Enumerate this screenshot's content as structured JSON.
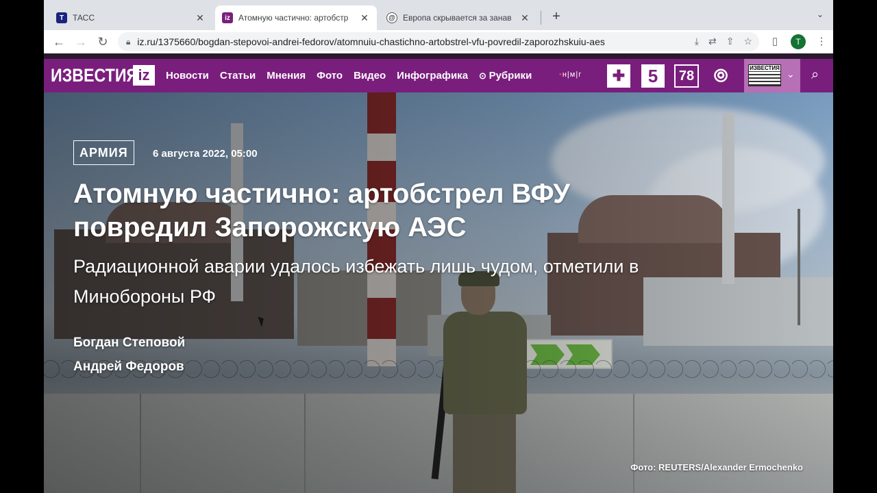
{
  "tabs": [
    {
      "title": "ТАСС",
      "favicon": "Т",
      "color": "#1a237e",
      "active": false
    },
    {
      "title": "Атомную частично: артобстр",
      "favicon": "iz",
      "color": "#7a1e7d",
      "active": true
    },
    {
      "title": "Европа скрывается за занав",
      "favicon": "@",
      "color": "#ffffff",
      "active": false
    }
  ],
  "toolbar": {
    "url": "iz.ru/1375660/bogdan-stepovoi-andrei-fedorov/atomnuiu-chastichno-artobstrel-vfu-povredil-zaporozhskuiu-aes",
    "profile_initial": "T"
  },
  "site": {
    "logo": "ИЗВЕСТИЯ",
    "logo_badge": "iz",
    "menu": [
      "Новости",
      "Статьи",
      "Мнения",
      "Фото",
      "Видео",
      "Инфографика",
      "Рубрики"
    ],
    "group_mark": "н|м|г",
    "channels": [
      "РЕН",
      "5",
      "78",
      "СТС"
    ],
    "paper_label": "ИЗВЕСТИЯ"
  },
  "article": {
    "rubric": "АРМИЯ",
    "date": "6 августа 2022, 05:00",
    "headline": "Атомную частично: артобстрел ВФУ повредил Запорожскую АЭС",
    "subheadline": "Радиационной аварии удалось избежать лишь чудом, отметили в Минобороны РФ",
    "authors": [
      "Богдан Степовой",
      "Андрей Федоров"
    ],
    "photo_credit": "Фото: REUTERS/Alexander Ermochenko"
  },
  "colors": {
    "brand": "#7a1e7d",
    "brand_light": "#b76fb5"
  }
}
